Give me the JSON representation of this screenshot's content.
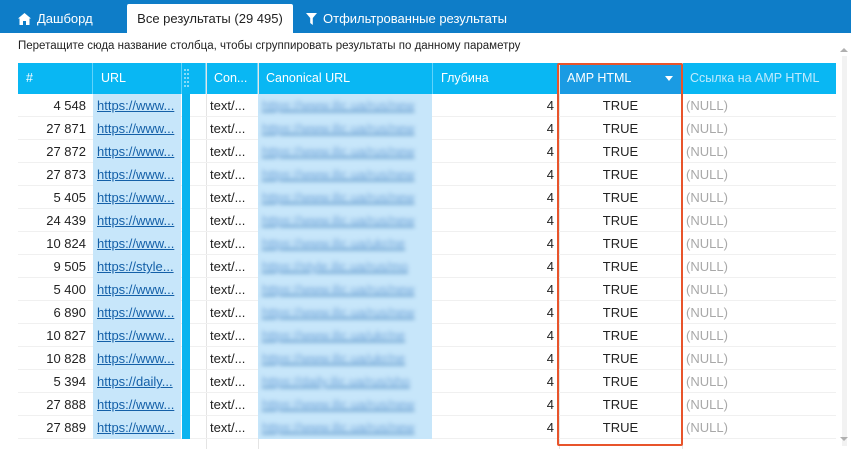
{
  "tabs": {
    "dashboard": "Дашборд",
    "all": "Все результаты (29 495)",
    "filtered": "Отфильтрованные результаты"
  },
  "hint": "Перетащите сюда название столбца, чтобы сгруппировать результаты по данному параметру",
  "columns": {
    "num": "#",
    "url": "URL",
    "content": "Con...",
    "canonical": "Canonical URL",
    "depth": "Глубина",
    "amp": "AMP HTML",
    "amp_link": "Ссылка на AMP HTML"
  },
  "rows": [
    {
      "num": "4 548",
      "url": "https://www...",
      "content": "text/...",
      "canonical": "https://www.ilic.ua/rus/new",
      "depth": "4",
      "amp": "TRUE",
      "amp_link": "(NULL)"
    },
    {
      "num": "27 871",
      "url": "https://www...",
      "content": "text/...",
      "canonical": "https://www.ilic.ua/rus/new",
      "depth": "4",
      "amp": "TRUE",
      "amp_link": "(NULL)"
    },
    {
      "num": "27 872",
      "url": "https://www...",
      "content": "text/...",
      "canonical": "https://www.ilic.ua/rus/new",
      "depth": "4",
      "amp": "TRUE",
      "amp_link": "(NULL)"
    },
    {
      "num": "27 873",
      "url": "https://www...",
      "content": "text/...",
      "canonical": "https://www.ilic.ua/rus/new",
      "depth": "4",
      "amp": "TRUE",
      "amp_link": "(NULL)"
    },
    {
      "num": "5 405",
      "url": "https://www...",
      "content": "text/...",
      "canonical": "https://www.ilic.ua/rus/new",
      "depth": "4",
      "amp": "TRUE",
      "amp_link": "(NULL)"
    },
    {
      "num": "24 439",
      "url": "https://www...",
      "content": "text/...",
      "canonical": "https://www.ilic.ua/rus/new",
      "depth": "4",
      "amp": "TRUE",
      "amp_link": "(NULL)"
    },
    {
      "num": "10 824",
      "url": "https://www...",
      "content": "text/...",
      "canonical": "https://www.ilic.ua/ukr/ne",
      "depth": "4",
      "amp": "TRUE",
      "amp_link": "(NULL)"
    },
    {
      "num": "9 505",
      "url": "https://style...",
      "content": "text/...",
      "canonical": "https://style.ilic.ua/rus/mo",
      "depth": "4",
      "amp": "TRUE",
      "amp_link": "(NULL)"
    },
    {
      "num": "5 400",
      "url": "https://www...",
      "content": "text/...",
      "canonical": "https://www.ilic.ua/rus/new",
      "depth": "4",
      "amp": "TRUE",
      "amp_link": "(NULL)"
    },
    {
      "num": "6 890",
      "url": "https://www...",
      "content": "text/...",
      "canonical": "https://www.ilic.ua/rus/new",
      "depth": "4",
      "amp": "TRUE",
      "amp_link": "(NULL)"
    },
    {
      "num": "10 827",
      "url": "https://www...",
      "content": "text/...",
      "canonical": "https://www.ilic.ua/ukr/ne",
      "depth": "4",
      "amp": "TRUE",
      "amp_link": "(NULL)"
    },
    {
      "num": "10 828",
      "url": "https://www...",
      "content": "text/...",
      "canonical": "https://www.ilic.ua/ukr/ne",
      "depth": "4",
      "amp": "TRUE",
      "amp_link": "(NULL)"
    },
    {
      "num": "5 394",
      "url": "https://daily...",
      "content": "text/...",
      "canonical": "https://daily.ilic.ua/rus/sho",
      "depth": "4",
      "amp": "TRUE",
      "amp_link": "(NULL)"
    },
    {
      "num": "27 888",
      "url": "https://www...",
      "content": "text/...",
      "canonical": "https://www.ilic.ua/rus/new",
      "depth": "4",
      "amp": "TRUE",
      "amp_link": "(NULL)"
    },
    {
      "num": "27 889",
      "url": "https://www...",
      "content": "text/...",
      "canonical": "https://www.ilic.ua/rus/new",
      "depth": "4",
      "amp": "TRUE",
      "amp_link": "(NULL)"
    }
  ],
  "colors": {
    "topbar": "#0e7dc8",
    "header": "#09b7f3",
    "url_cell_bg": "#c7e6fa",
    "highlight": "#e8542b",
    "null_text": "#a8a8a8"
  },
  "icons": {
    "dashboard": "home-icon",
    "filtered": "filter-icon",
    "sort": "sort-desc-icon",
    "scroll_up": "scroll-up-icon",
    "scroll_down": "scroll-down-icon"
  }
}
